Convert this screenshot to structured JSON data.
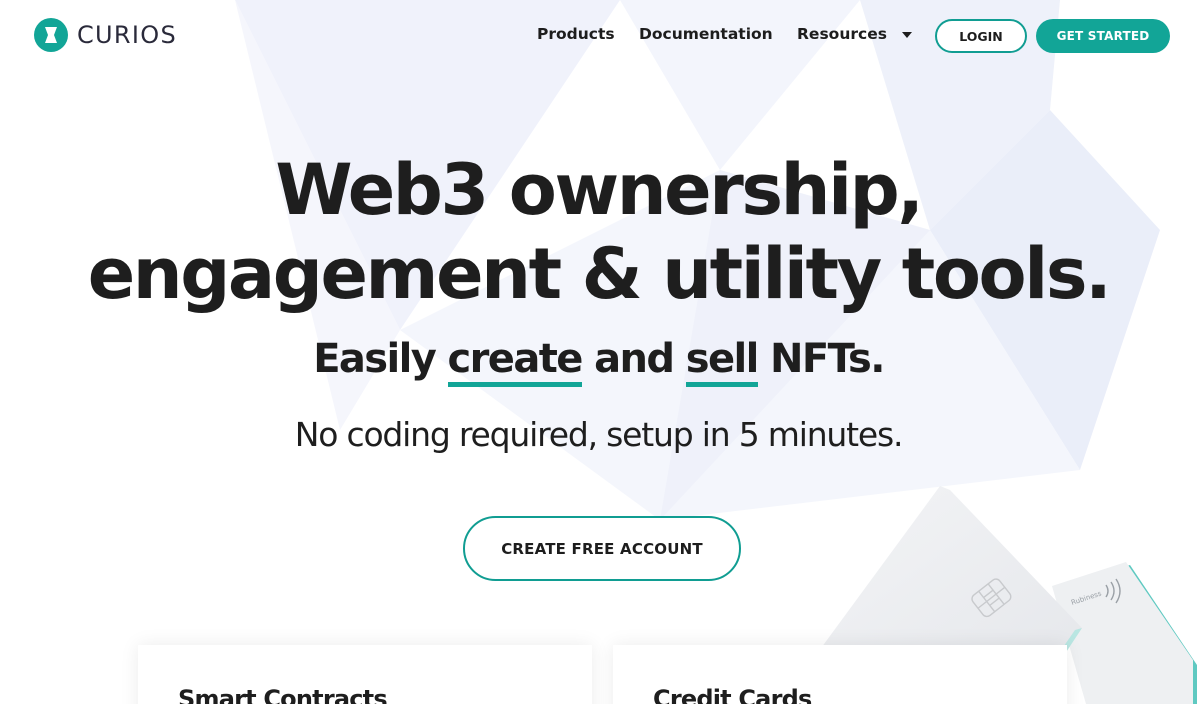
{
  "brand": {
    "name": "CURIOS",
    "accent": "#12a597"
  },
  "nav": {
    "products": "Products",
    "documentation": "Documentation",
    "resources": "Resources",
    "login": "LOGIN",
    "get_started": "GET STARTED"
  },
  "hero": {
    "title_line1": "Web3 ownership,",
    "title_line2": "engagement & utility tools.",
    "sub_part1": "Easily ",
    "sub_create": "create",
    "sub_part2": " and ",
    "sub_sell": "sell",
    "sub_part3": " NFTs.",
    "line3": "No coding required, setup in 5 minutes.",
    "cta": "CREATE FREE ACCOUNT"
  },
  "illustration": {
    "card_text": "Rubiness"
  },
  "features": [
    {
      "title": "Smart Contracts"
    },
    {
      "title": "Credit Cards"
    }
  ]
}
